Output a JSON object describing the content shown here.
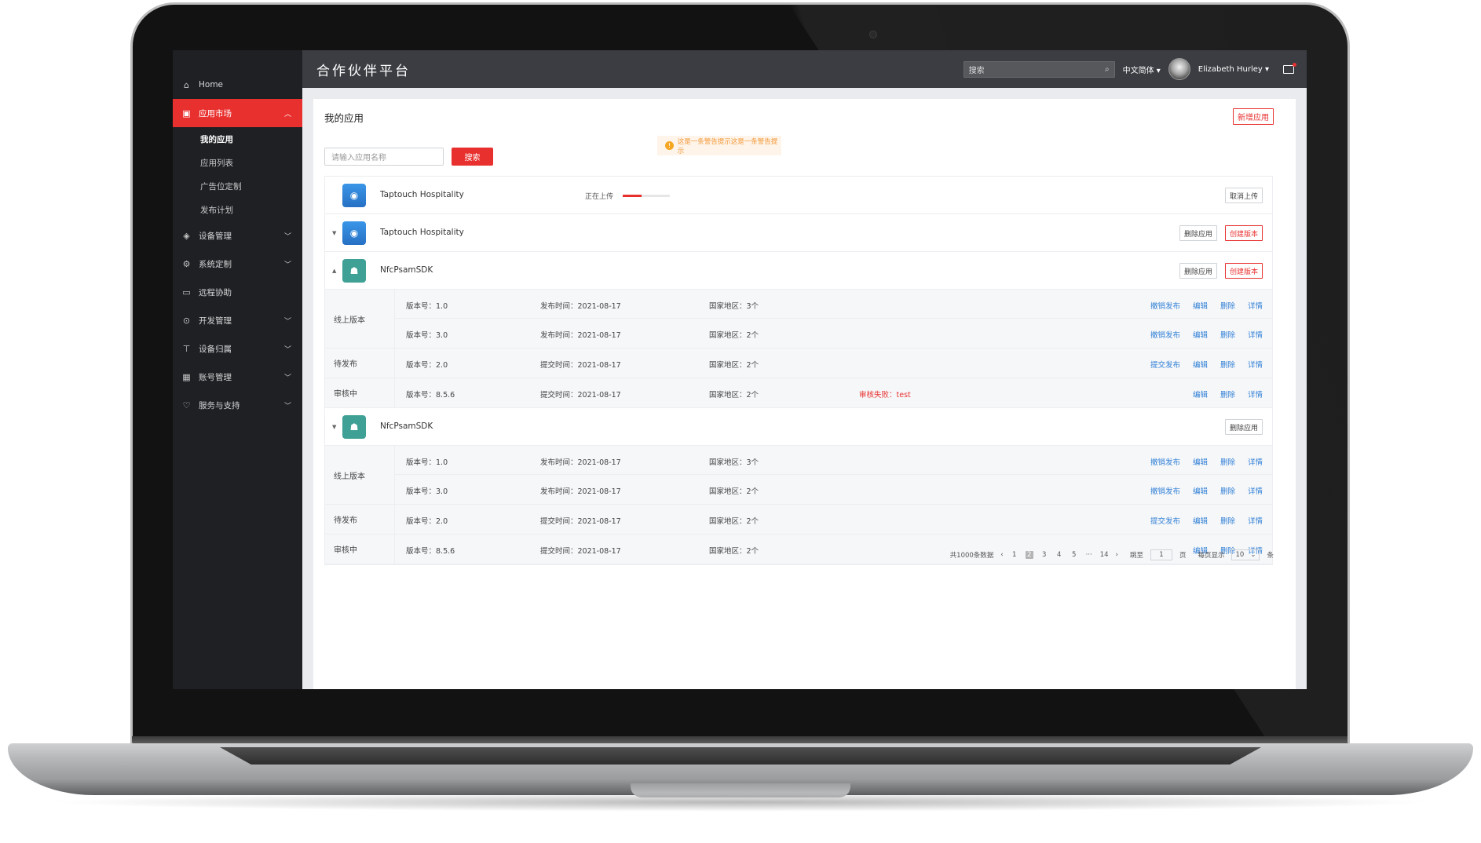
{
  "topbar": {
    "brand": "合作伙伴平台",
    "search_placeholder": "搜索",
    "language": "中文简体",
    "user_name": "Elizabeth Hurley"
  },
  "sidebar": {
    "items": [
      {
        "label": "Home",
        "icon": "home-icon"
      },
      {
        "label": "应用市场",
        "icon": "store-icon",
        "active": true,
        "children": [
          "我的应用",
          "应用列表",
          "广告位定制",
          "发布计划"
        ],
        "active_child": "我的应用"
      },
      {
        "label": "设备管理",
        "icon": "layers-icon"
      },
      {
        "label": "系统定制",
        "icon": "settings-icon"
      },
      {
        "label": "远程协助",
        "icon": "monitor-icon"
      },
      {
        "label": "开发管理",
        "icon": "dev-icon"
      },
      {
        "label": "设备归属",
        "icon": "terminal-icon"
      },
      {
        "label": "账号管理",
        "icon": "account-icon"
      },
      {
        "label": "服务与支持",
        "icon": "support-icon"
      }
    ]
  },
  "main": {
    "title": "我的应用",
    "add_button": "新增应用",
    "alert": "这是一条警告提示这是一条警告提示",
    "search_placeholder": "请输入应用名称",
    "search_button": "搜索",
    "uploading_label": "正在上传",
    "upload_progress": 0.4,
    "cancel_upload": "取消上传",
    "delete_app": "删除应用",
    "create_version": "创建版本",
    "apps": [
      {
        "name": "Taptouch Hospitality"
      },
      {
        "name": "Taptouch Hospitality"
      },
      {
        "name": "NfcPsamSDK"
      },
      {
        "name": "NfcPsamSDK"
      }
    ],
    "groups": {
      "online": "线上版本",
      "pending": "待发布",
      "reviewing": "审核中"
    },
    "actions": {
      "revoke": "撤销发布",
      "submit": "提交发布",
      "edit": "编辑",
      "delete": "删除",
      "detail": "详情"
    },
    "rows": {
      "online_1": {
        "version": "版本号：1.0",
        "time": "发布时间：2021-08-17",
        "region": "国家地区：3个"
      },
      "online_2": {
        "version": "版本号：3.0",
        "time": "发布时间：2021-08-17",
        "region": "国家地区：2个"
      },
      "pending": {
        "version": "版本号：2.0",
        "time": "提交时间：2021-08-17",
        "region": "国家地区：2个"
      },
      "reviewing": {
        "version": "版本号：8.5.6",
        "time": "提交时间：2021-08-17",
        "region": "国家地区：2个",
        "fail": "审核失败：test"
      }
    }
  },
  "pagination": {
    "total": "共1000条数据",
    "pages": [
      "1",
      "2",
      "3",
      "4",
      "5",
      "···",
      "14"
    ],
    "active": "2",
    "goto_label": "跳至",
    "goto_value": "1",
    "page_unit": "页",
    "per_page_label": "每页显示",
    "per_page_value": "10",
    "per_page_unit": "条"
  }
}
